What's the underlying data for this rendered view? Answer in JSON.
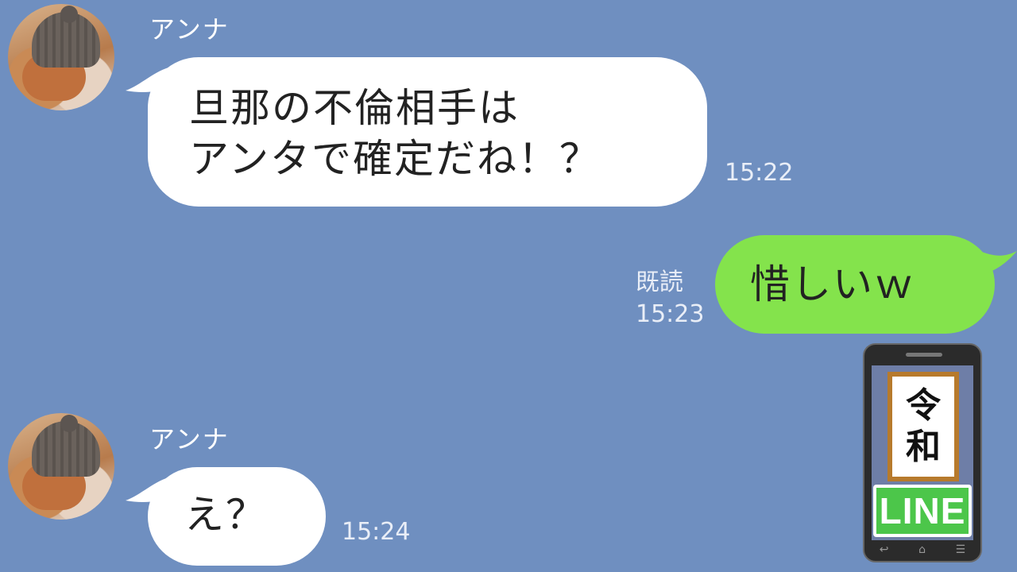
{
  "messages": [
    {
      "sender": "アンナ",
      "lines": [
        "旦那の不倫相手は",
        "アンタで確定だね！？"
      ],
      "time": "15:22"
    },
    {
      "text": "惜しいｗ",
      "read_label": "既読",
      "time": "15:23"
    },
    {
      "sender": "アンナ",
      "text": "え？",
      "time": "15:24"
    }
  ],
  "badge": {
    "era_line1": "令",
    "era_line2": "和",
    "app_name": "LINE",
    "nav_icons": [
      "back-icon",
      "home-icon",
      "menu-icon"
    ]
  },
  "colors": {
    "background": "#6f8fc0",
    "incoming_bubble": "#ffffff",
    "outgoing_bubble": "#84e34c"
  }
}
